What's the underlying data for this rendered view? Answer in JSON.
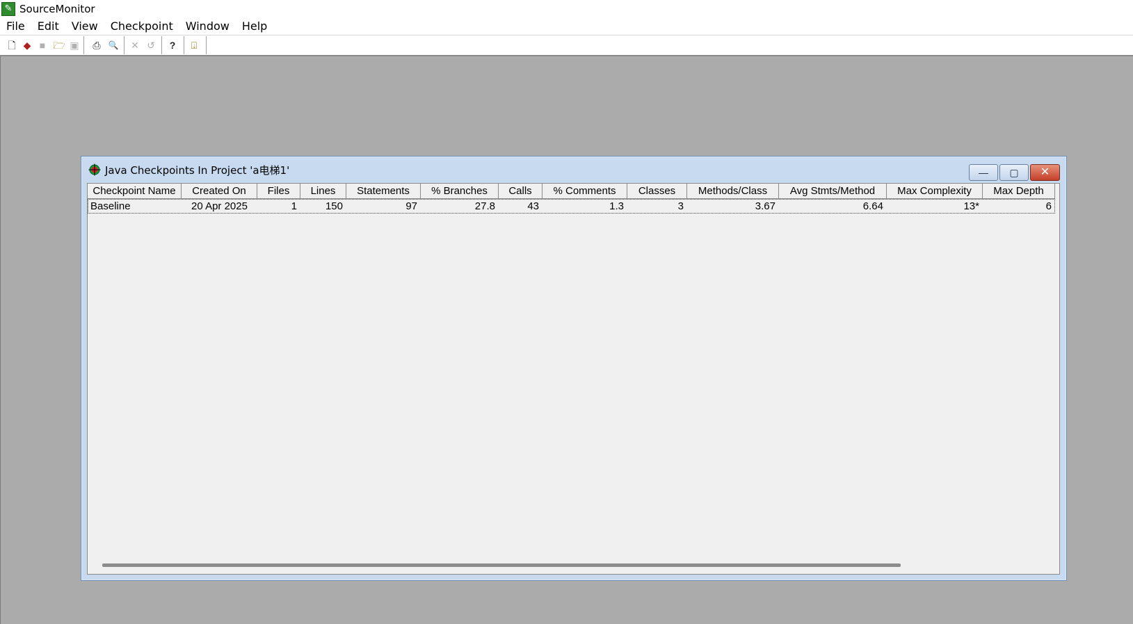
{
  "app": {
    "title": "SourceMonitor",
    "icon": "sourcemonitor-app-icon"
  },
  "menu": [
    "File",
    "Edit",
    "View",
    "Checkpoint",
    "Window",
    "Help"
  ],
  "toolbar": {
    "buttons": [
      {
        "icon": "new-file-icon",
        "glyph": "🗋",
        "enabled": true
      },
      {
        "icon": "new-checkpoint-icon",
        "glyph": "◆",
        "enabled": true
      },
      {
        "icon": "copy-checkpoint-icon",
        "glyph": "■",
        "enabled": false
      },
      {
        "icon": "open-folder-icon",
        "glyph": "🗁",
        "enabled": true
      },
      {
        "icon": "save-icon",
        "glyph": "▣",
        "enabled": false
      },
      {
        "icon": "print-icon",
        "glyph": "⎙",
        "enabled": true
      },
      {
        "icon": "print-preview-icon",
        "glyph": "🔍",
        "enabled": true
      },
      {
        "icon": "delete-icon",
        "glyph": "✕",
        "enabled": false
      },
      {
        "icon": "undo-icon",
        "glyph": "↺",
        "enabled": false
      },
      {
        "icon": "context-help-icon",
        "glyph": "?",
        "enabled": true
      },
      {
        "icon": "exit-icon",
        "glyph": "⍗",
        "enabled": true
      }
    ]
  },
  "child_window": {
    "title": "Java Checkpoints In Project 'a电梯1'",
    "icon": "checkpoint-target-icon",
    "minimize_glyph": "—",
    "maximize_glyph": "▢",
    "close_glyph": "✕"
  },
  "table": {
    "columns": [
      "Checkpoint Name",
      "Created On",
      "Files",
      "Lines",
      "Statements",
      "% Branches",
      "Calls",
      "% Comments",
      "Classes",
      "Methods/Class",
      "Avg Stmts/Method",
      "Max Complexity",
      "Max Depth"
    ],
    "rows": [
      [
        "Baseline",
        "20 Apr 2025",
        "1",
        "150",
        "97",
        "27.8",
        "43",
        "1.3",
        "3",
        "3.67",
        "6.64",
        "13*",
        "6"
      ]
    ]
  },
  "colors": {
    "mdi_background": "#ababab",
    "child_frame": "#c7daf0",
    "close_button": "#c3402a"
  }
}
